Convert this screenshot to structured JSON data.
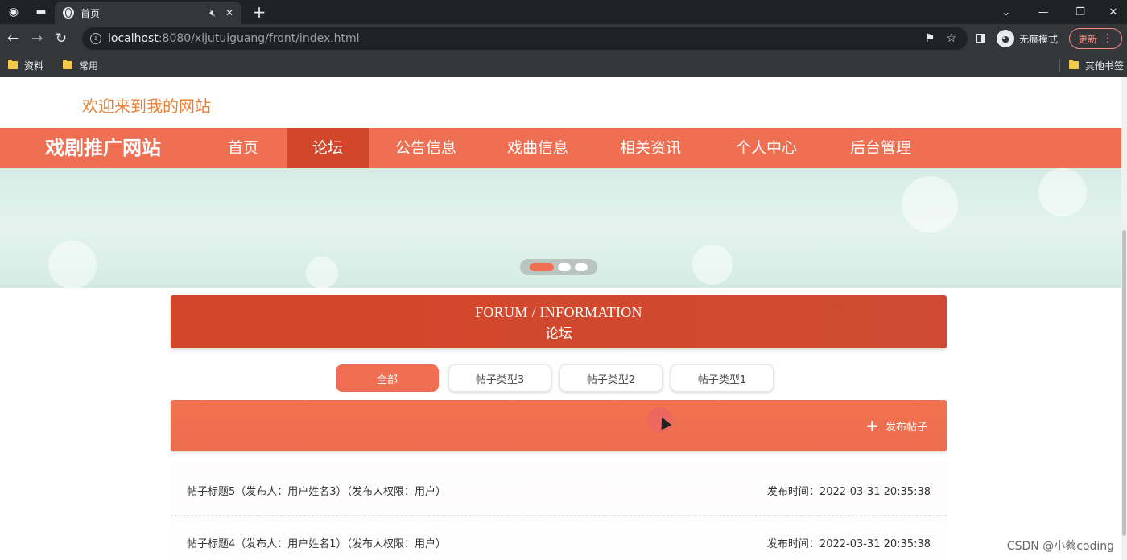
{
  "browser": {
    "tab_title": "首页",
    "url_host": "localhost",
    "url_rest": ":8080/xijutuiguang/front/index.html",
    "incognito_label": "无痕模式",
    "update_label": "更新",
    "bookmarks": [
      "资料",
      "常用"
    ],
    "other_bookmarks": "其他书签"
  },
  "site": {
    "welcome": "欢迎来到我的网站",
    "brand": "戏剧推广网站",
    "nav": [
      "首页",
      "论坛",
      "公告信息",
      "戏曲信息",
      "相关资讯",
      "个人中心",
      "后台管理"
    ],
    "active_nav": "论坛",
    "accent_color": "#ee6f52",
    "active_nav_color": "#d2462a",
    "welcome_color": "#e8823a"
  },
  "banner": {
    "slide_count": 3,
    "active_slide": 1
  },
  "forum": {
    "title_en": "FORUM / INFORMATION",
    "title_cn": "论坛",
    "filters": [
      "全部",
      "帖子类型3",
      "帖子类型2",
      "帖子类型1"
    ],
    "active_filter": "全部",
    "post_button": "发布帖子",
    "posts": [
      {
        "title": "帖子标题5（发布人：用户姓名3）（发布人权限：用户）",
        "time": "发布时间：2022-03-31 20:35:38"
      },
      {
        "title": "帖子标题4（发布人：用户姓名1）（发布人权限：用户）",
        "time": "发布时间：2022-03-31 20:35:38"
      }
    ]
  },
  "watermark": "CSDN @小蔡coding"
}
